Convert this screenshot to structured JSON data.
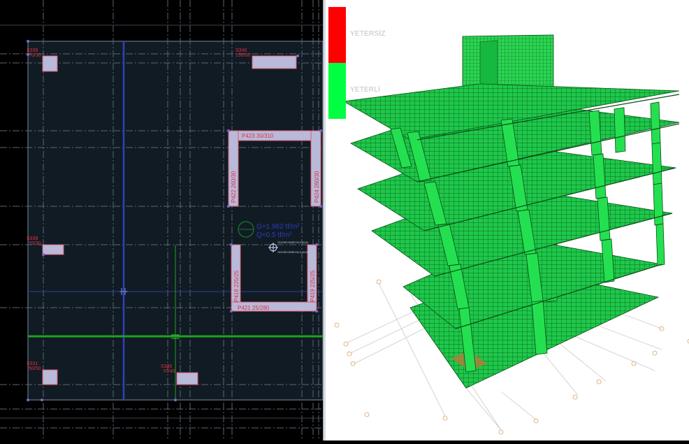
{
  "plan": {
    "columns": [
      {
        "id": "s336",
        "label": "S336",
        "size": "70/30"
      },
      {
        "id": "s340",
        "label": "S340",
        "size": "150/30"
      },
      {
        "id": "s338",
        "label": "S338",
        "size": "70/30"
      },
      {
        "id": "s331",
        "label": "S331",
        "size": "50/50"
      },
      {
        "id": "s330",
        "label": "S330",
        "size": "70/40"
      }
    ],
    "walls": [
      {
        "id": "p423",
        "label": "P423 30/310"
      },
      {
        "id": "p422",
        "label": "P422 260/30"
      },
      {
        "id": "p424",
        "label": "P424 260/30"
      },
      {
        "id": "p418",
        "label": "P418 225/25"
      },
      {
        "id": "p419",
        "label": "P419 225/25"
      },
      {
        "id": "p421",
        "label": "P421 25/280"
      }
    ],
    "loads": {
      "g": "G=1.962 tf/m²",
      "q": "Q=0.5 tf/m²"
    },
    "cursor_note": {
      "line1": "YENİ BİR DEMİR EKLE (S110)",
      "line2": "YENİ BİR DEMİR EKLE (S110)"
    }
  },
  "view3d": {
    "legend": [
      {
        "label": "YETERSİZ",
        "color": "#ff0000"
      },
      {
        "label": "YETERLİ",
        "color": "#00ff40"
      }
    ],
    "model_color": "#19d84a",
    "mesh_color": "#0a4d16"
  }
}
